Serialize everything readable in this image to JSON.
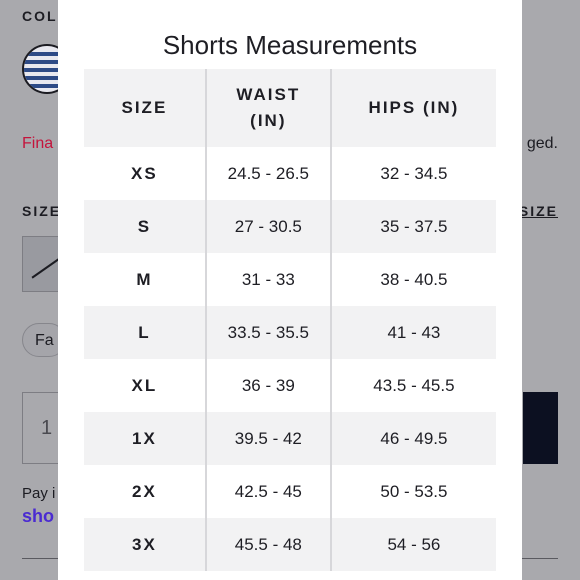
{
  "background": {
    "color_label": "COL",
    "final_sale_text": "Fina",
    "exchanged_text": "ged.",
    "size_label": "SIZE",
    "size_guide_link": "SIZE",
    "fav_label": "Fa",
    "quantity": "1",
    "pay_text": "Pay i",
    "shop_text": "sho"
  },
  "modal": {
    "title": "Shorts Measurements",
    "headers": {
      "size": "SIZE",
      "waist_line1": "WAIST",
      "waist_line2": "(IN)",
      "hips": "HIPS (IN)"
    },
    "rows": [
      {
        "size": "XS",
        "waist": "24.5 - 26.5",
        "hips": "32 - 34.5"
      },
      {
        "size": "S",
        "waist": "27 - 30.5",
        "hips": "35 - 37.5"
      },
      {
        "size": "M",
        "waist": "31 - 33",
        "hips": "38 - 40.5"
      },
      {
        "size": "L",
        "waist": "33.5 - 35.5",
        "hips": "41 - 43"
      },
      {
        "size": "XL",
        "waist": "36 - 39",
        "hips": "43.5 - 45.5"
      },
      {
        "size": "1X",
        "waist": "39.5 - 42",
        "hips": "46 - 49.5"
      },
      {
        "size": "2X",
        "waist": "42.5 - 45",
        "hips": "50 - 53.5"
      },
      {
        "size": "3X",
        "waist": "45.5 - 48",
        "hips": "54 - 56"
      }
    ]
  },
  "colors": {
    "overlay": "#a9a9ad",
    "sale_red": "#c4143c",
    "shop_purple": "#4b2bd1",
    "button_dark": "#0c1021",
    "row_alt": "#f2f2f3"
  }
}
